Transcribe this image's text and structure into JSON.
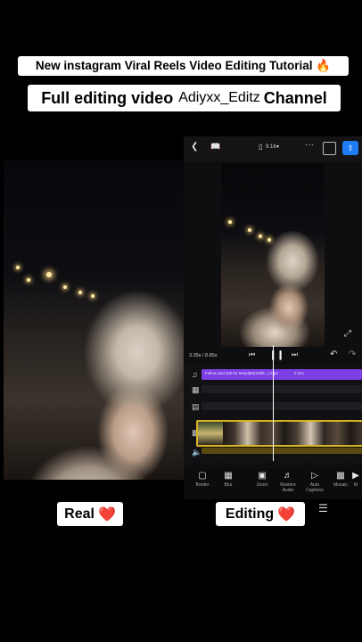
{
  "header": {
    "line1": "New instagram Viral Reels Video Editing Tutorial 🔥",
    "line2_pre": "Full editing video",
    "line2_channel": "Adiyxx_Editz",
    "line2_post": "Channel"
  },
  "editor": {
    "ratio": "9:16",
    "timecode": "3.39s / 8.85s",
    "audio_label": "Follow and ask for template(1080...).mp4",
    "audio_time": "8.85s",
    "track_icons": {
      "audio": "music-note-icon",
      "effect": "effect-icon",
      "text": "text-icon",
      "video": "video-icon",
      "volume": "volume-icon"
    },
    "tools": [
      {
        "label": "Border",
        "icon": "border-icon"
      },
      {
        "label": "Blur",
        "icon": "blur-icon"
      },
      {
        "label": "Zoom",
        "icon": "zoom-icon"
      },
      {
        "label": "Restore Audio",
        "icon": "restore-audio-icon"
      },
      {
        "label": "Auto Captions",
        "icon": "auto-captions-icon"
      },
      {
        "label": "Mosaic",
        "icon": "mosaic-icon"
      },
      {
        "label": "M",
        "icon": "more-icon"
      }
    ]
  },
  "labels": {
    "real": "Real",
    "editing": "Editing",
    "heart": "❤️"
  },
  "colors": {
    "accent_blue": "#1f7cf5",
    "audio_purple": "#7b3fe4",
    "video_border": "#d8b423",
    "heart": "#e0212f"
  }
}
